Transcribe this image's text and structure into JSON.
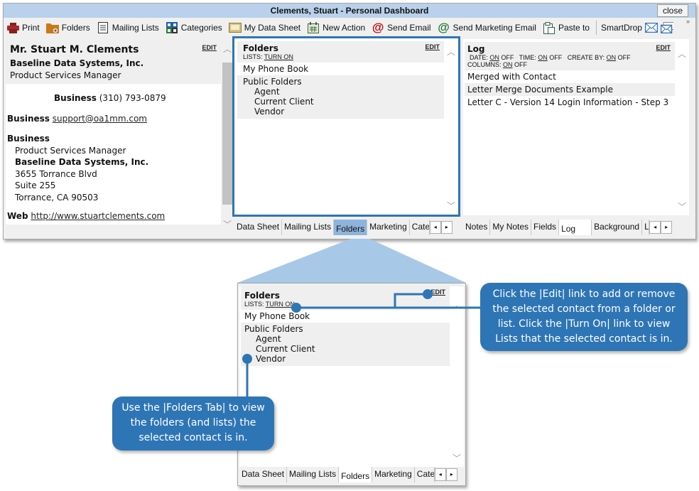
{
  "window": {
    "title": "Clements, Stuart - Personal Dashboard",
    "close_label": "close"
  },
  "toolbar": {
    "items": [
      {
        "label": "Print",
        "icon": "printer-icon"
      },
      {
        "label": "Folders",
        "icon": "folder-add-icon"
      },
      {
        "label": "Mailing Lists",
        "icon": "clipboard-list-icon"
      },
      {
        "label": "Categories",
        "icon": "grid-icon"
      },
      {
        "label": "My Data Sheet",
        "icon": "data-sheet-icon"
      },
      {
        "label": "New Action",
        "icon": "calendar-icon"
      },
      {
        "label": "Send Email",
        "icon": "at-red-icon"
      },
      {
        "label": "Send Marketing Email",
        "icon": "at-green-icon"
      },
      {
        "label": "Paste to",
        "icon": "paste-icon"
      }
    ],
    "smartdrop_label": "SmartDrop",
    "overflow": "»"
  },
  "contact": {
    "edit": "EDIT",
    "name": "Mr. Stuart M. Clements",
    "company": "Baseline Data Systems, Inc.",
    "title": "Product Services Manager",
    "phone_label": "Business",
    "phone": "(310) 793-0879",
    "email_label": "Business",
    "email": "support@oa1mm.com",
    "address_label": "Business",
    "address_title": "Product Services Manager",
    "address_company": "Baseline Data Systems, Inc.",
    "address_line1": "3655 Torrance Blvd",
    "address_line2": "Suite 255",
    "address_city": "Torrance, CA 90503",
    "web_label": "Web",
    "web": "http://www.stuartclements.com"
  },
  "folders": {
    "title": "Folders",
    "edit": "EDIT",
    "lists_label": "LISTS:",
    "lists_link": "TURN ON",
    "my_phone_book": "My Phone Book",
    "public_folders": "Public Folders",
    "items": [
      "Agent",
      "Current Client",
      "Vendor"
    ],
    "tabs": [
      "Data Sheet",
      "Mailing Lists",
      "Folders",
      "Marketing",
      "Cate"
    ]
  },
  "log": {
    "title": "Log",
    "edit": "EDIT",
    "date_label": "DATE:",
    "time_label": "TIME:",
    "create_label": "CREATE BY:",
    "columns_label": "COLUMNS:",
    "on": "ON",
    "off": "OFF",
    "entries": [
      "Merged with Contact",
      "Letter Merge Documents Example",
      "Letter C - Version 14 Login Information - Step 3"
    ],
    "tabs": [
      "Notes",
      "My Notes",
      "Fields",
      "Log",
      "Background",
      "L"
    ]
  },
  "callouts": {
    "edit_hint": "Click the |Edit| link to add or remove the selected contact from a folder or list.  Click the |Turn On| link to view Lists that the selected contact is in.",
    "tab_hint": "Use the |Folders Tab| to view the folders (and lists) the selected contact is in."
  },
  "colors": {
    "accent": "#2e75b6",
    "title_bar": "#b9d1ea",
    "zoom_cone": "#a8c8e8"
  }
}
